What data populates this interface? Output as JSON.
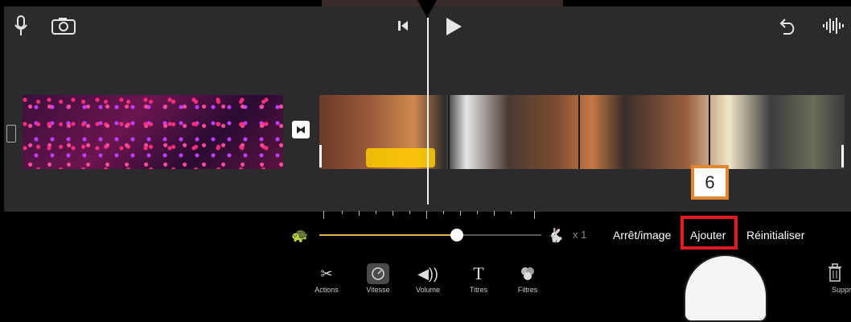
{
  "toolbar": {
    "icons": [
      "microphone-icon",
      "camera-icon",
      "skip-to-start-icon",
      "play-icon",
      "undo-icon",
      "audio-waveform-icon"
    ]
  },
  "timeline": {
    "transition_icon": "transition-icon"
  },
  "speed": {
    "multiplier_label": "x 1",
    "slider_value": 0.62
  },
  "speed_options": {
    "freeze_frame": "Arrêt/image",
    "add": "Ajouter",
    "reset": "Réinitialiser"
  },
  "annotation": {
    "step_number": "6"
  },
  "tools": {
    "actions": "Actions",
    "speed": "Vitesse",
    "volume": "Volume",
    "titles": "Titres",
    "filters": "Filtres",
    "delete": "Supprimer"
  },
  "colors": {
    "accent": "#e3b34a",
    "highlight_red": "#e01b22",
    "badge_orange": "#e4852f",
    "selection_yellow": "#ffcd00"
  }
}
